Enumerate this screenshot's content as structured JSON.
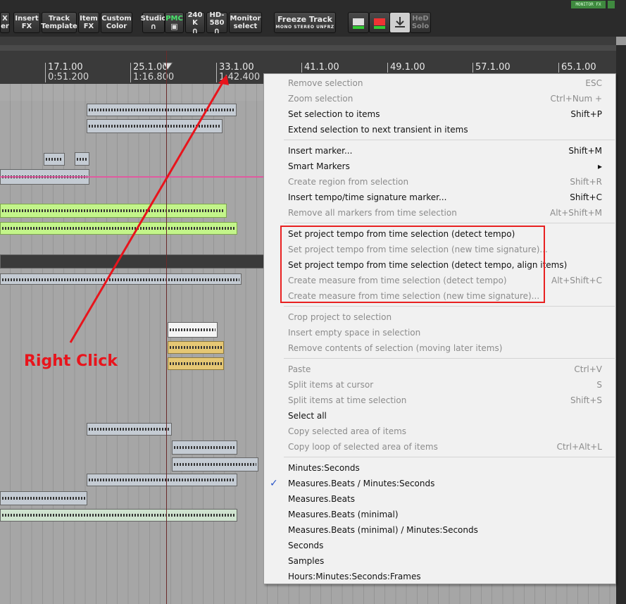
{
  "toolbar": {
    "partial_label": {
      "l1": "X",
      "l2": "er"
    },
    "insert_fx": {
      "l1": "Insert",
      "l2": "FX"
    },
    "track_template": {
      "l1": "Track",
      "l2": "Template"
    },
    "item_fx": {
      "l1": "Item",
      "l2": "FX"
    },
    "custom_color": {
      "l1": "Custom",
      "l2": "Color"
    },
    "studio": "Studio",
    "pmc": "PMC",
    "k240": "240 K",
    "hd580": "HD-580",
    "monitor_select": {
      "l1": "Monitor",
      "l2": "select"
    },
    "freeze_track": {
      "title": "Freeze Track",
      "mono": "MONO",
      "stereo": "STEREO",
      "unfrz": "UNFRZ"
    },
    "hed_solo": {
      "l1": "HeD",
      "l2": "Solo"
    },
    "monitor_fx": "MONITOR FX"
  },
  "ruler": [
    {
      "bar": "17.1.00",
      "time": "0:51.200"
    },
    {
      "bar": "25.1.00",
      "time": "1:16.800"
    },
    {
      "bar": "33.1.00",
      "time": "1:42.400"
    },
    {
      "bar": "41.1.00",
      "time": ""
    },
    {
      "bar": "49.1.00",
      "time": ""
    },
    {
      "bar": "57.1.00",
      "time": ""
    },
    {
      "bar": "65.1.00",
      "time": ""
    }
  ],
  "annotation": {
    "label": "Right Click",
    "color": "#e8141c"
  },
  "menu": {
    "items": [
      {
        "label": "Remove selection",
        "shortcut": "ESC",
        "disabled": true
      },
      {
        "label": "Zoom selection",
        "shortcut": "Ctrl+Num +",
        "disabled": true
      },
      {
        "label": "Set selection to items",
        "shortcut": "Shift+P",
        "disabled": false
      },
      {
        "label": "Extend selection to next transient in items",
        "shortcut": "",
        "disabled": false
      },
      {
        "label": "Insert marker...",
        "shortcut": "Shift+M",
        "disabled": false
      },
      {
        "label": "Smart Markers",
        "shortcut": "",
        "submenu": "▸",
        "disabled": false
      },
      {
        "label": "Create region from selection",
        "shortcut": "Shift+R",
        "disabled": true
      },
      {
        "label": "Insert tempo/time signature marker...",
        "shortcut": "Shift+C",
        "disabled": false
      },
      {
        "label": "Remove all markers from time selection",
        "shortcut": "Alt+Shift+M",
        "disabled": true
      },
      {
        "label": "Set project tempo from time selection (detect tempo)",
        "shortcut": "",
        "disabled": false
      },
      {
        "label": "Set project tempo from time selection (new time signature)...",
        "shortcut": "",
        "disabled": true
      },
      {
        "label": "Set project tempo from time selection (detect tempo, align items)",
        "shortcut": "",
        "disabled": false
      },
      {
        "label": "Create measure from time selection (detect tempo)",
        "shortcut": "Alt+Shift+C",
        "disabled": true
      },
      {
        "label": "Create measure from time selection (new time signature)...",
        "shortcut": "",
        "disabled": true
      },
      {
        "label": "Crop project to selection",
        "shortcut": "",
        "disabled": true
      },
      {
        "label": "Insert empty space in selection",
        "shortcut": "",
        "disabled": true
      },
      {
        "label": "Remove contents of selection (moving later items)",
        "shortcut": "",
        "disabled": true
      },
      {
        "label": "Paste",
        "shortcut": "Ctrl+V",
        "disabled": true
      },
      {
        "label": "Split items at cursor",
        "shortcut": "S",
        "disabled": true
      },
      {
        "label": "Split items at time selection",
        "shortcut": "Shift+S",
        "disabled": true
      },
      {
        "label": "Select all",
        "shortcut": "",
        "disabled": false
      },
      {
        "label": "Copy selected area of items",
        "shortcut": "",
        "disabled": true
      },
      {
        "label": "Copy loop of selected area of items",
        "shortcut": "Ctrl+Alt+L",
        "disabled": true
      },
      {
        "label": "Minutes:Seconds",
        "shortcut": "",
        "disabled": false
      },
      {
        "label": "Measures.Beats / Minutes:Seconds",
        "shortcut": "",
        "checked": "✓",
        "disabled": false
      },
      {
        "label": "Measures.Beats",
        "shortcut": "",
        "disabled": false
      },
      {
        "label": "Measures.Beats (minimal)",
        "shortcut": "",
        "disabled": false
      },
      {
        "label": "Measures.Beats (minimal) / Minutes:Seconds",
        "shortcut": "",
        "disabled": false
      },
      {
        "label": "Seconds",
        "shortcut": "",
        "disabled": false
      },
      {
        "label": "Samples",
        "shortcut": "",
        "disabled": false
      },
      {
        "label": "Hours:Minutes:Seconds:Frames",
        "shortcut": "",
        "disabled": false
      }
    ]
  }
}
